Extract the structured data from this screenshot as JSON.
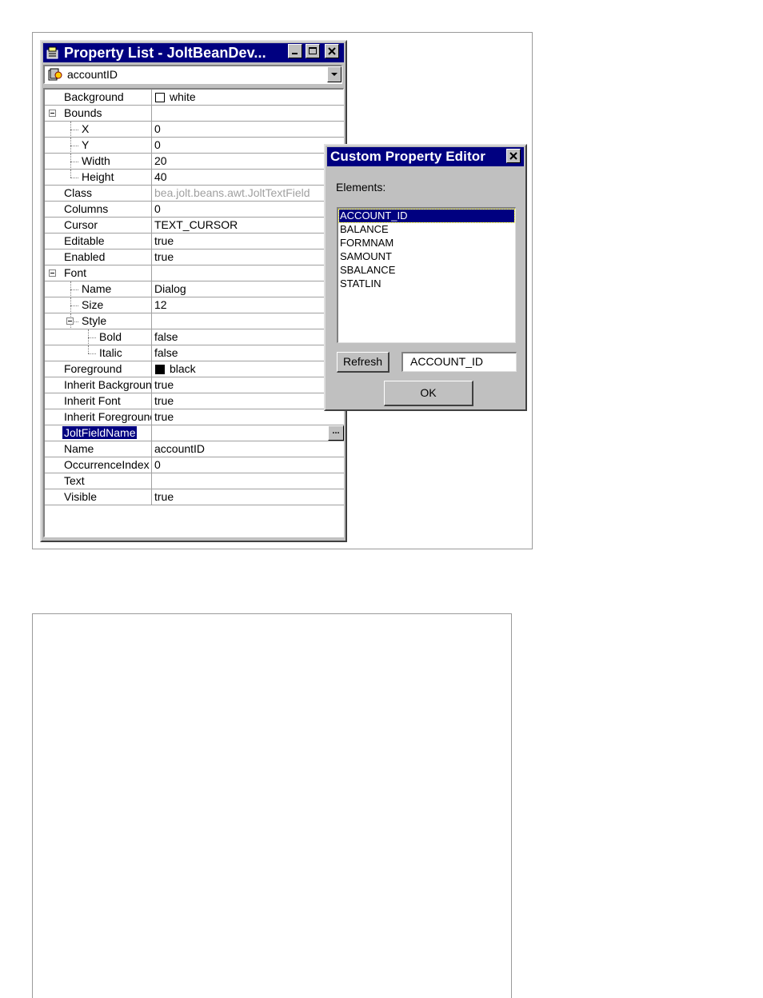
{
  "property_list": {
    "title": "Property List - JoltBeanDev...",
    "selected_bean": "accountID",
    "rows": [
      {
        "name": "Background",
        "value": "white",
        "level": 0,
        "swatch": "#ffffff"
      },
      {
        "name": "Bounds",
        "value": "",
        "level": 0,
        "expander": true
      },
      {
        "name": "X",
        "value": "0",
        "level": 1
      },
      {
        "name": "Y",
        "value": "0",
        "level": 1
      },
      {
        "name": "Width",
        "value": "20",
        "level": 1
      },
      {
        "name": "Height",
        "value": "40",
        "level": 1,
        "last": true
      },
      {
        "name": "Class",
        "value": "bea.jolt.beans.awt.JoltTextField",
        "level": 0,
        "greyed": true
      },
      {
        "name": "Columns",
        "value": "0",
        "level": 0
      },
      {
        "name": "Cursor",
        "value": "TEXT_CURSOR",
        "level": 0
      },
      {
        "name": "Editable",
        "value": "true",
        "level": 0
      },
      {
        "name": "Enabled",
        "value": "true",
        "level": 0
      },
      {
        "name": "Font",
        "value": "",
        "level": 0,
        "expander": true
      },
      {
        "name": "Name",
        "value": "Dialog",
        "level": 1
      },
      {
        "name": "Size",
        "value": "12",
        "level": 1
      },
      {
        "name": "Style",
        "value": "",
        "level": 1,
        "expander": true
      },
      {
        "name": "Bold",
        "value": "false",
        "level": 2
      },
      {
        "name": "Italic",
        "value": "false",
        "level": 2,
        "last": true
      },
      {
        "name": "Foreground",
        "value": "black",
        "level": 0,
        "swatch": "#000000"
      },
      {
        "name": "Inherit Background",
        "value": "true",
        "level": 0
      },
      {
        "name": "Inherit Font",
        "value": "true",
        "level": 0
      },
      {
        "name": "Inherit Foreground",
        "value": "true",
        "level": 0
      },
      {
        "name": "JoltFieldName",
        "value": "",
        "level": 0,
        "selected": true,
        "ellipsis": true
      },
      {
        "name": "Name",
        "value": "accountID",
        "level": 0
      },
      {
        "name": "OccurrenceIndex",
        "value": "0",
        "level": 0
      },
      {
        "name": "Text",
        "value": "",
        "level": 0
      },
      {
        "name": "Visible",
        "value": "true",
        "level": 0
      }
    ],
    "ellipsis_label": "..."
  },
  "custom_editor": {
    "title": "Custom Property Editor",
    "elements_label": "Elements:",
    "elements": [
      "ACCOUNT_ID",
      "BALANCE",
      "FORMNAM",
      "SAMOUNT",
      "SBALANCE",
      "STATLIN"
    ],
    "selected_index": 0,
    "refresh_label": "Refresh",
    "field_value": "ACCOUNT_ID",
    "ok_label": "OK"
  },
  "colors": {
    "title_bar": "#000080",
    "face": "#c0c0c0",
    "selection": "#000080"
  }
}
